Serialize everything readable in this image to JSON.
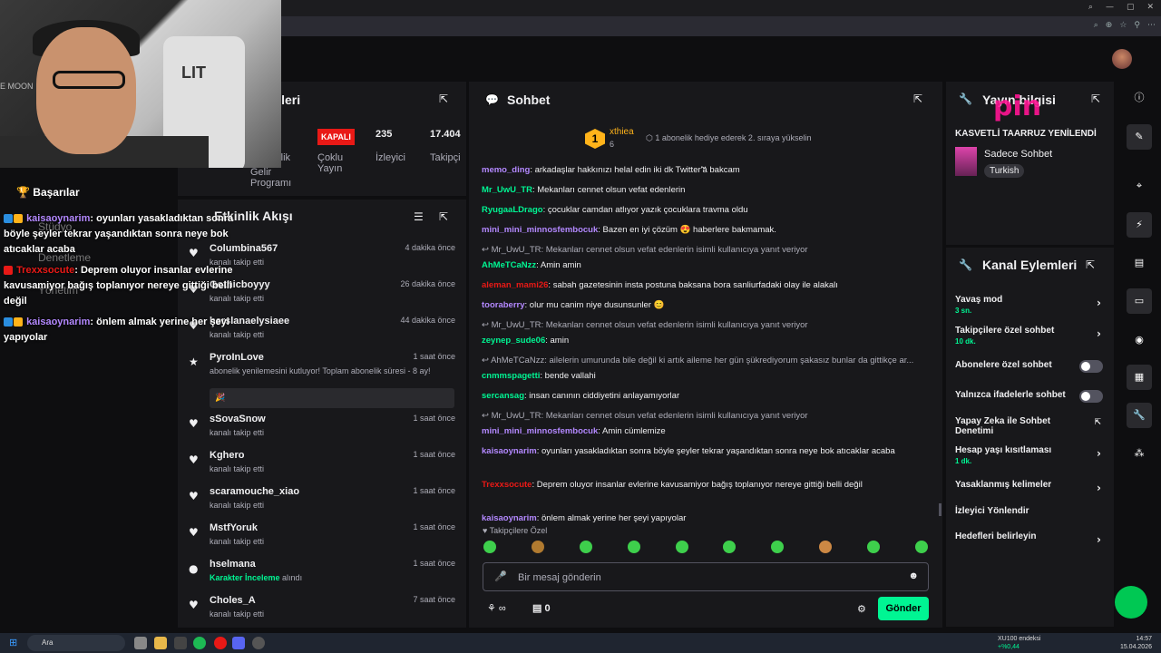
{
  "browser": {
    "controls": [
      "⌕",
      "—",
      "▢",
      "✕"
    ]
  },
  "stats": {
    "title": "stikleri",
    "cells": [
      {
        "value": "",
        "label": "Gelir Programı",
        "extra": "rlik"
      },
      {
        "value": "KAPALI",
        "label": "Çoklu Yayın"
      },
      {
        "value": "235",
        "label": "İzleyici"
      },
      {
        "value": "17.404",
        "label": "Takipçi"
      }
    ]
  },
  "overlay": {
    "achievements": "Başarılar",
    "bg_labels": [
      "Stüdyo",
      "Denetleme",
      "Yönetim"
    ],
    "messages": [
      {
        "user": "kaisaoynarim",
        "text": ": oyunları yasakladıktan sonra böyle şeyler tekrar yaşandıktan sonra neye bok atıcaklar acaba"
      },
      {
        "user": "Trexxsocute",
        "text": ": Deprem oluyor insanlar evlerine kavusamiyor bağış toplanıyor nereye gittiği belli değil"
      },
      {
        "user": "kaisaoynarim",
        "text": ": önlem almak yerine her şeyi yapıyolar"
      }
    ]
  },
  "feed": {
    "title": "Etkinlik Akışı",
    "items": [
      {
        "name": "Columbina567",
        "sub": "kanalı takip etti",
        "time": "4 dakika önce",
        "icon": "♥"
      },
      {
        "name": "Gothicboyyy",
        "sub": "kanalı takip etti",
        "time": "26 dakika önce",
        "icon": "♥"
      },
      {
        "name": "herslanaelysiaee",
        "sub": "kanalı takip etti",
        "time": "44 dakika önce",
        "icon": "♥"
      },
      {
        "name": "PyroInLove",
        "sub": "abonelik yenilemesini kutluyor! Toplam abonelik süresi - 8 ay!",
        "time": "1 saat önce",
        "icon": "★"
      },
      {
        "name": "sSovaSnow",
        "sub": "kanalı takip etti",
        "time": "1 saat önce",
        "icon": "♥"
      },
      {
        "name": "Kghero",
        "sub": "kanalı takip etti",
        "time": "1 saat önce",
        "icon": "♥"
      },
      {
        "name": "scaramouche_xiao",
        "sub": "kanalı takip etti",
        "time": "1 saat önce",
        "icon": "♥"
      },
      {
        "name": "MstfYoruk",
        "sub": "kanalı takip etti",
        "time": "1 saat önce",
        "icon": "♥"
      },
      {
        "name": "hselmana",
        "sub_green": "Karakter İnceleme",
        "sub": " alındı",
        "time": "1 saat önce",
        "icon": "●"
      },
      {
        "name": "Choles_A",
        "sub": "kanalı takip etti",
        "time": "7 saat önce",
        "icon": "♥"
      }
    ],
    "sub_bubble": "🎉"
  },
  "chat": {
    "title": "Sohbet",
    "pinned_rank": "1",
    "pinned_user": "xthiea",
    "pinned_count": "6",
    "pinned_text": "1 abonelik hediye ederek 2. sıraya yükselin",
    "messages": [
      {
        "user": "memo_ding",
        "color": "#b388ff",
        "text": ": arkadaşlar hakkınızı helal edin iki dk Twitter'a bakcam"
      },
      {
        "user": "Mr_UwU_TR",
        "color": "#00f593",
        "text": ": Mekanları cennet olsun vefat edenlerin"
      },
      {
        "user": "RyugaaLDrago",
        "color": "#00f593",
        "text": ": çocuklar camdan atlıyor yazık çocuklara travma oldu"
      },
      {
        "user": "mini_mini_minnosfembocuk",
        "color": "#b388ff",
        "text": ": Bazen en iyi çözüm 😍 haberlere bakmamak."
      },
      {
        "reply": "↩ Mr_UwU_TR: Mekanları cennet olsun vefat edenlerin isimli kullanıcıya yanıt veriyor"
      },
      {
        "user": "AhMeTCaNzz",
        "color": "#00f593",
        "text": ": Amin amin"
      },
      {
        "user": "aleman_mami26",
        "color": "#e91916",
        "text": ": sabah gazetesinin insta postuna baksana bora sanliurfadaki olay ile alakalı"
      },
      {
        "user": "tooraberry",
        "color": "#b388ff",
        "text": ": olur mu canim niye dusunsunler 😊"
      },
      {
        "reply": "↩ Mr_UwU_TR: Mekanları cennet olsun vefat edenlerin isimli kullanıcıya yanıt veriyor"
      },
      {
        "user": "zeynep_sude06",
        "color": "#00f593",
        "text": ": amin"
      },
      {
        "reply": "↩ AhMeTCaNzz: ailelerin umurunda bile değil ki artık aileme her gün şükrediyorum şakasız bunlar da gittikçe ar..."
      },
      {
        "user": "cnmmspagetti",
        "color": "#00f593",
        "text": ": bende vallahi"
      },
      {
        "user": "sercansag",
        "color": "#00f593",
        "text": ": insan canının ciddiyetini anlayamıyorlar"
      },
      {
        "reply": "↩ Mr_UwU_TR: Mekanları cennet olsun vefat edenlerin isimli kullanıcıya yanıt veriyor"
      },
      {
        "user": "mini_mini_minnosfembocuk",
        "color": "#b388ff",
        "text": ": Amin cümlemize"
      },
      {
        "user": "kaisaoynarim",
        "color": "#b388ff",
        "text": ": oyunları yasakladıktan sonra böyle şeyler tekrar yaşandıktan sonra neye bok atıcaklar acaba"
      },
      {
        "user": "Trexxsocute",
        "color": "#e91916",
        "text": ": Deprem oluyor insanlar evlerine kavusamiyor bağış toplanıyor nereye gittiği belli değil"
      },
      {
        "user": "kaisaoynarim",
        "color": "#b388ff",
        "text": ": önlem almak yerine her şeyi yapıyolar"
      }
    ],
    "follower_only": "♥ Takipçilere Özel",
    "placeholder": "Bir mesaj gönderin",
    "send": "Gönder",
    "points": "∞",
    "count": "0"
  },
  "info": {
    "title": "Yayın bilgisi",
    "stream_title": "KASVETLİ TAARRUZ YENİLENDİ",
    "category": "Sadece Sohbet",
    "tag": "Turkish"
  },
  "actions": {
    "title": "Kanal Eylemleri",
    "rows": [
      {
        "label": "Yavaş mod",
        "sub": "3 sn.",
        "type": "chevron"
      },
      {
        "label": "Takipçilere özel sohbet",
        "sub": "10 dk.",
        "type": "chevron"
      },
      {
        "label": "Abonelere özel sohbet",
        "sub": "",
        "type": "toggle"
      },
      {
        "label": "Yalnızca ifadelerle sohbet",
        "sub": "",
        "type": "toggle"
      },
      {
        "label": "Yapay Zeka ile Sohbet Denetimi",
        "sub": "",
        "type": "external"
      },
      {
        "label": "Hesap yaşı kısıtlaması",
        "sub": "1 dk.",
        "type": "chevron"
      },
      {
        "label": "Yasaklanmış kelimeler",
        "sub": "",
        "type": "chevron"
      },
      {
        "label": "İzleyici Yönlendir",
        "sub": "",
        "type": "none"
      },
      {
        "label": "Hedefleri belirleyin",
        "sub": "",
        "type": "chevron"
      }
    ]
  },
  "watermark": "pin",
  "taskbar": {
    "search": "Ara",
    "ticker_name": "XU100 endeksi",
    "ticker_change": "+%0,44",
    "time": "14:57",
    "date": "15.04.2026"
  }
}
